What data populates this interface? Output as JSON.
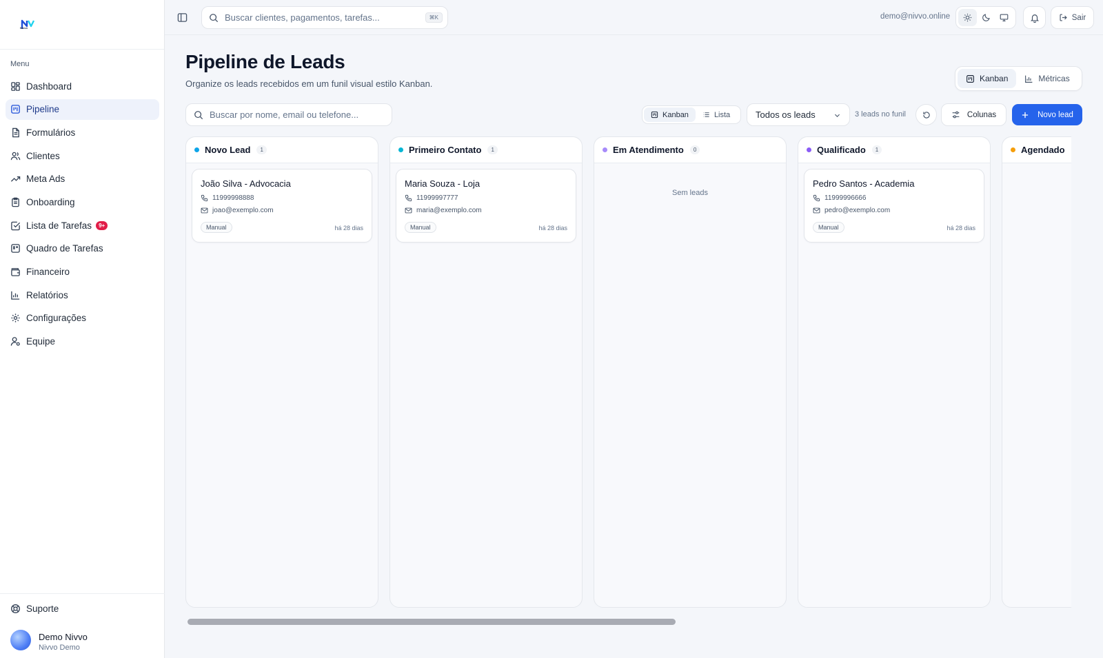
{
  "brand": {
    "logo_text": "Nivvo"
  },
  "sidebar": {
    "menu_title": "Menu",
    "items": [
      {
        "label": "Dashboard",
        "icon": "dashboard-icon"
      },
      {
        "label": "Pipeline",
        "icon": "kanban-icon",
        "active": true
      },
      {
        "label": "Formulários",
        "icon": "file-text-icon"
      },
      {
        "label": "Clientes",
        "icon": "users-icon"
      },
      {
        "label": "Meta Ads",
        "icon": "trending-up-icon"
      },
      {
        "label": "Onboarding",
        "icon": "clipboard-icon"
      },
      {
        "label": "Lista de Tarefas",
        "icon": "check-square-icon",
        "badge": "9+"
      },
      {
        "label": "Quadro de Tarefas",
        "icon": "board-icon"
      },
      {
        "label": "Financeiro",
        "icon": "wallet-icon"
      },
      {
        "label": "Relatórios",
        "icon": "bar-chart-icon"
      },
      {
        "label": "Configurações",
        "icon": "gear-icon"
      },
      {
        "label": "Equipe",
        "icon": "user-team-icon"
      }
    ],
    "support_label": "Suporte",
    "user": {
      "name": "Demo Nivvo",
      "org": "Nivvo Demo"
    }
  },
  "topbar": {
    "search_placeholder": "Buscar clientes, pagamentos, tarefas...",
    "shortcut": "⌘K",
    "email": "demo@nivvo.online",
    "logout_label": "Sair"
  },
  "header": {
    "title": "Pipeline de Leads",
    "subtitle": "Organize os leads recebidos em um funil visual estilo Kanban.",
    "view_tabs": [
      {
        "label": "Kanban",
        "selected": true
      },
      {
        "label": "Métricas"
      }
    ]
  },
  "toolbar": {
    "search_placeholder": "Buscar por nome, email ou telefone...",
    "layout_options": [
      {
        "label": "Kanban",
        "selected": true
      },
      {
        "label": "Lista"
      }
    ],
    "filter_value": "Todos os leads",
    "leads_count": "3 leads no funil",
    "columns_label": "Colunas",
    "new_lead_label": "Novo lead"
  },
  "colors": {
    "accent": "#2563eb",
    "badge": "#e11d48"
  },
  "board": {
    "empty_text": "Sem leads",
    "columns": [
      {
        "title": "Novo Lead",
        "count": "1",
        "color": "#0ea5e9",
        "cards": [
          {
            "name": "João Silva - Advocacia",
            "phone": "11999998888",
            "email": "joao@exemplo.com",
            "source": "Manual",
            "age": "há 28 dias"
          }
        ]
      },
      {
        "title": "Primeiro Contato",
        "count": "1",
        "color": "#06b6d4",
        "cards": [
          {
            "name": "Maria Souza - Loja",
            "phone": "11999997777",
            "email": "maria@exemplo.com",
            "source": "Manual",
            "age": "há 28 dias"
          }
        ]
      },
      {
        "title": "Em Atendimento",
        "count": "0",
        "color": "#a78bfa",
        "cards": []
      },
      {
        "title": "Qualificado",
        "count": "1",
        "color": "#8b5cf6",
        "cards": [
          {
            "name": "Pedro Santos - Academia",
            "phone": "11999996666",
            "email": "pedro@exemplo.com",
            "source": "Manual",
            "age": "há 28 dias"
          }
        ]
      },
      {
        "title": "Agendado",
        "count": "",
        "color": "#f59e0b",
        "cards": []
      }
    ]
  }
}
